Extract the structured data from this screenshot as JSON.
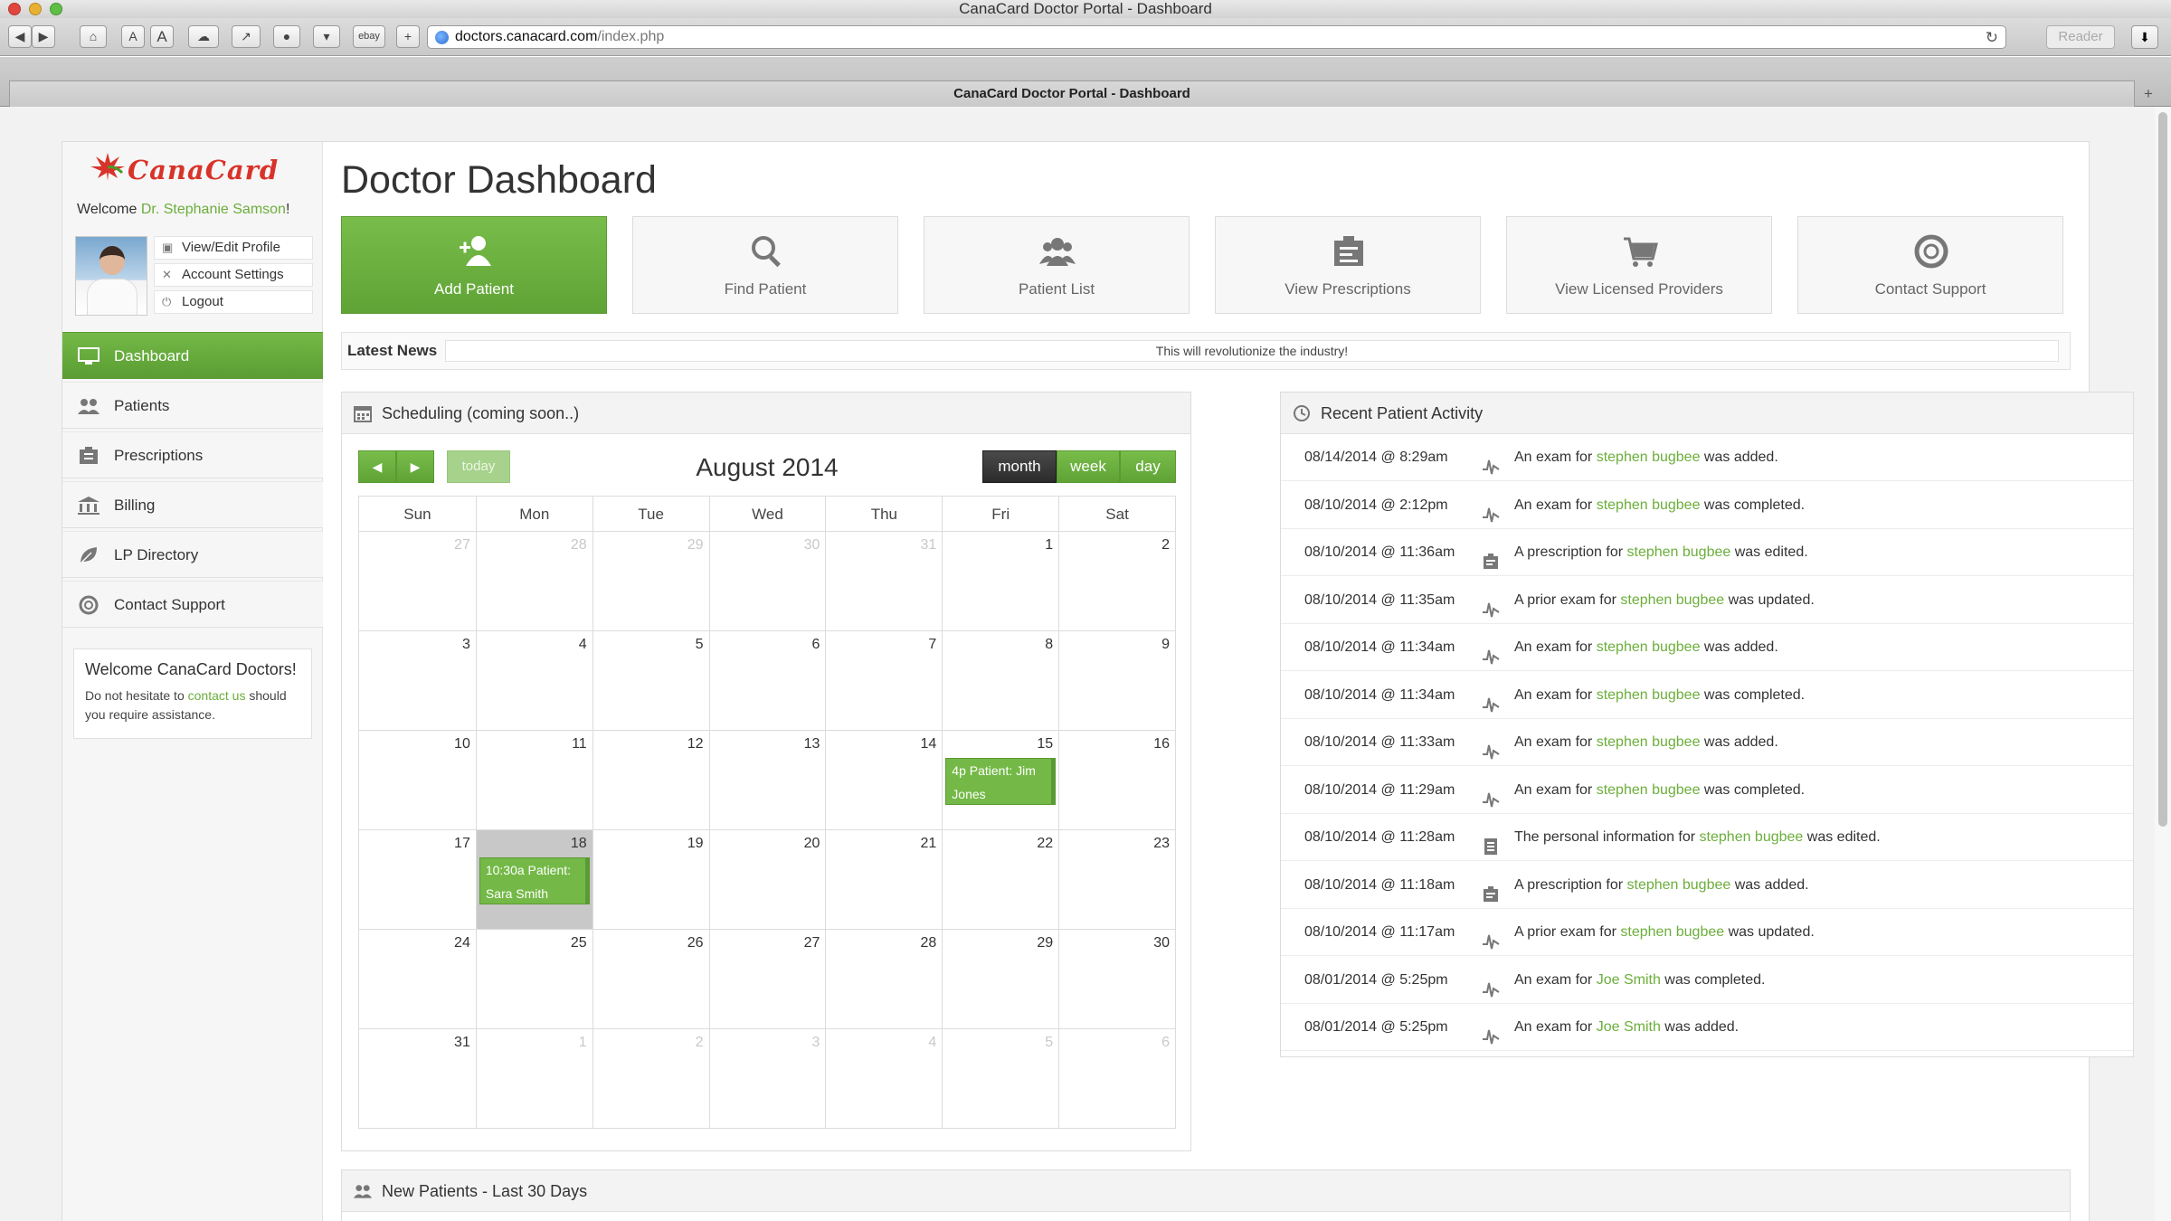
{
  "browser": {
    "window_title": "CanaCard Doctor Portal - Dashboard",
    "url_host": "doctors.canacard.com",
    "url_path": "/index.php",
    "reader_label": "Reader",
    "tab_title": "CanaCard Doctor Portal - Dashboard",
    "toolbar": {
      "font_small": "A",
      "font_large": "A",
      "ebay": "ebay",
      "add": "+"
    }
  },
  "sidebar": {
    "logo_text": "CanaCard",
    "welcome_prefix": "Welcome ",
    "doctor_name": "Dr. Stephanie Samson",
    "welcome_suffix": "!",
    "profile_links": [
      {
        "label": "View/Edit Profile",
        "icon": "profile-icon"
      },
      {
        "label": "Account Settings",
        "icon": "settings-icon"
      },
      {
        "label": "Logout",
        "icon": "power-icon"
      }
    ],
    "nav": [
      {
        "label": "Dashboard",
        "icon": "monitor-icon",
        "active": true
      },
      {
        "label": "Patients",
        "icon": "users-icon",
        "active": false
      },
      {
        "label": "Prescriptions",
        "icon": "prescription-icon",
        "active": false
      },
      {
        "label": "Billing",
        "icon": "bank-icon",
        "active": false
      },
      {
        "label": "LP Directory",
        "icon": "leaf-icon",
        "active": false
      },
      {
        "label": "Contact Support",
        "icon": "lifebuoy-icon",
        "active": false
      }
    ],
    "help": {
      "title": "Welcome CanaCard Doctors!",
      "text_before": "Do not hesitate to ",
      "link": "contact us",
      "text_after": " should you require assistance."
    }
  },
  "main": {
    "title": "Doctor Dashboard",
    "actions": [
      {
        "label": "Add Patient",
        "icon": "add-user-icon",
        "primary": true
      },
      {
        "label": "Find Patient",
        "icon": "search-icon",
        "primary": false
      },
      {
        "label": "Patient List",
        "icon": "users-icon",
        "primary": false
      },
      {
        "label": "View Prescriptions",
        "icon": "prescription-icon",
        "primary": false
      },
      {
        "label": "View Licensed Providers",
        "icon": "cart-icon",
        "primary": false
      },
      {
        "label": "Contact Support",
        "icon": "lifebuoy-icon",
        "primary": false
      }
    ],
    "news": {
      "label": "Latest News",
      "text": "This will revolutionize the industry!"
    }
  },
  "scheduling": {
    "title": "Scheduling (coming soon..)",
    "prev": "◀",
    "next": "▶",
    "today_label": "today",
    "month_title": "August 2014",
    "views": [
      "month",
      "week",
      "day"
    ],
    "active_view": "month",
    "weekdays": [
      "Sun",
      "Mon",
      "Tue",
      "Wed",
      "Thu",
      "Fri",
      "Sat"
    ],
    "weeks": [
      [
        {
          "d": "27",
          "o": true
        },
        {
          "d": "28",
          "o": true
        },
        {
          "d": "29",
          "o": true
        },
        {
          "d": "30",
          "o": true
        },
        {
          "d": "31",
          "o": true
        },
        {
          "d": "1"
        },
        {
          "d": "2"
        }
      ],
      [
        {
          "d": "3"
        },
        {
          "d": "4"
        },
        {
          "d": "5"
        },
        {
          "d": "6"
        },
        {
          "d": "7"
        },
        {
          "d": "8"
        },
        {
          "d": "9"
        }
      ],
      [
        {
          "d": "10"
        },
        {
          "d": "11"
        },
        {
          "d": "12"
        },
        {
          "d": "13"
        },
        {
          "d": "14"
        },
        {
          "d": "15",
          "event": "4p  Patient: Jim Jones"
        },
        {
          "d": "16"
        }
      ],
      [
        {
          "d": "17"
        },
        {
          "d": "18",
          "today": true,
          "event": "10:30a  Patient: Sara Smith"
        },
        {
          "d": "19"
        },
        {
          "d": "20"
        },
        {
          "d": "21"
        },
        {
          "d": "22"
        },
        {
          "d": "23"
        }
      ],
      [
        {
          "d": "24"
        },
        {
          "d": "25"
        },
        {
          "d": "26"
        },
        {
          "d": "27"
        },
        {
          "d": "28"
        },
        {
          "d": "29"
        },
        {
          "d": "30"
        }
      ],
      [
        {
          "d": "31"
        },
        {
          "d": "1",
          "o": true
        },
        {
          "d": "2",
          "o": true
        },
        {
          "d": "3",
          "o": true
        },
        {
          "d": "4",
          "o": true
        },
        {
          "d": "5",
          "o": true
        },
        {
          "d": "6",
          "o": true
        }
      ]
    ]
  },
  "activity": {
    "title": "Recent Patient Activity",
    "rows": [
      {
        "time": "08/14/2014 @ 8:29am",
        "icon": "pulse-icon",
        "before": "An exam for ",
        "patient": "stephen bugbee",
        "after": " was added."
      },
      {
        "time": "08/10/2014 @ 2:12pm",
        "icon": "pulse-icon",
        "before": "An exam for ",
        "patient": "stephen bugbee",
        "after": " was completed."
      },
      {
        "time": "08/10/2014 @ 11:36am",
        "icon": "prescription-icon",
        "before": "A prescription for ",
        "patient": "stephen bugbee",
        "after": " was edited."
      },
      {
        "time": "08/10/2014 @ 11:35am",
        "icon": "pulse-icon",
        "before": "A prior exam for ",
        "patient": "stephen bugbee",
        "after": " was updated."
      },
      {
        "time": "08/10/2014 @ 11:34am",
        "icon": "pulse-icon",
        "before": "An exam for ",
        "patient": "stephen bugbee",
        "after": " was added."
      },
      {
        "time": "08/10/2014 @ 11:34am",
        "icon": "pulse-icon",
        "before": "An exam for ",
        "patient": "stephen bugbee",
        "after": " was completed."
      },
      {
        "time": "08/10/2014 @ 11:33am",
        "icon": "pulse-icon",
        "before": "An exam for ",
        "patient": "stephen bugbee",
        "after": " was added."
      },
      {
        "time": "08/10/2014 @ 11:29am",
        "icon": "pulse-icon",
        "before": "An exam for ",
        "patient": "stephen bugbee",
        "after": " was completed."
      },
      {
        "time": "08/10/2014 @ 11:28am",
        "icon": "document-icon",
        "before": "The personal information for ",
        "patient": "stephen bugbee",
        "after": " was edited."
      },
      {
        "time": "08/10/2014 @ 11:18am",
        "icon": "prescription-icon",
        "before": "A prescription for ",
        "patient": "stephen bugbee",
        "after": " was added."
      },
      {
        "time": "08/10/2014 @ 11:17am",
        "icon": "pulse-icon",
        "before": "A prior exam for ",
        "patient": "stephen bugbee",
        "after": " was updated."
      },
      {
        "time": "08/01/2014 @ 5:25pm",
        "icon": "pulse-icon",
        "before": "An exam for ",
        "patient": "Joe Smith",
        "after": " was completed."
      },
      {
        "time": "08/01/2014 @ 5:25pm",
        "icon": "pulse-icon",
        "before": "An exam for ",
        "patient": "Joe Smith",
        "after": " was added."
      }
    ]
  },
  "new_patients": {
    "title": "New Patients - Last 30 Days"
  },
  "colors": {
    "accent": "#6cae3b",
    "brand_red": "#d8332a",
    "dark_button": "#2b2b2b"
  }
}
